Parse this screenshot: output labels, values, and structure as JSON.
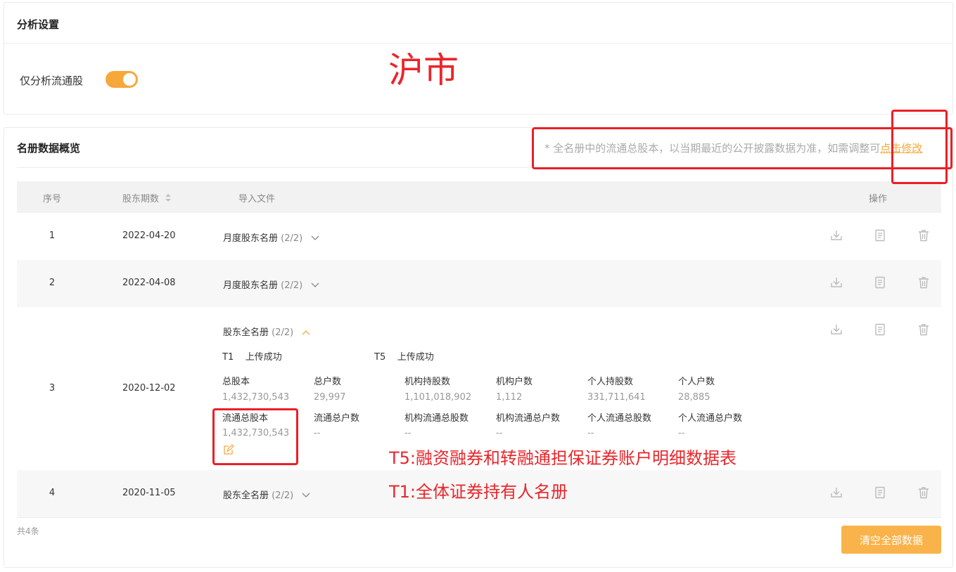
{
  "settings": {
    "title": "分析设置",
    "only_float_label": "仅分析流通股",
    "only_float_enabled": true
  },
  "annotations": {
    "market": "沪市",
    "t5_legend": "T5:融资融券和转融通担保证券账户明细数据表",
    "t1_legend": "T1:全体证券持有人名册",
    "color": "#e8262b"
  },
  "overview": {
    "title": "名册数据概览",
    "note_text": "* 全名册中的流通总股本，以当期最近的公开披露数据为准，如需调整可",
    "note_link": "点击修改",
    "columns": {
      "index": "序号",
      "period": "股东期数",
      "file": "导入文件",
      "ops": "操作"
    },
    "rows": [
      {
        "index": "1",
        "period": "2022-04-20",
        "file_name": "月度股东名册",
        "file_count": "(2/2)"
      },
      {
        "index": "2",
        "period": "2022-04-08",
        "file_name": "月度股东名册",
        "file_count": "(2/2)"
      },
      {
        "index": "3",
        "period": "2020-12-02",
        "file_name": "股东全名册",
        "file_count": "(2/2)",
        "uploads": [
          {
            "code": "T1",
            "status": "上传成功"
          },
          {
            "code": "T5",
            "status": "上传成功"
          }
        ],
        "stats": [
          {
            "label": "总股本",
            "value": "1,432,730,543"
          },
          {
            "label": "总户数",
            "value": "29,997"
          },
          {
            "label": "机构持股数",
            "value": "1,101,018,902"
          },
          {
            "label": "机构户数",
            "value": "1,112"
          },
          {
            "label": "个人持股数",
            "value": "331,711,641"
          },
          {
            "label": "个人户数",
            "value": "28,885"
          },
          {
            "label": "流通总股本",
            "value": "1,432,730,543"
          },
          {
            "label": "流通总户数",
            "value": "--"
          },
          {
            "label": "机构流通总股数",
            "value": "--"
          },
          {
            "label": "机构流通总户数",
            "value": "--"
          },
          {
            "label": "个人流通总股数",
            "value": "--"
          },
          {
            "label": "个人流通总户数",
            "value": "--"
          }
        ]
      },
      {
        "index": "4",
        "period": "2020-11-05",
        "file_name": "股东全名册",
        "file_count": "(2/2)"
      }
    ],
    "total": "共4条",
    "clear_button": "清空全部数据"
  },
  "colors": {
    "accent": "#f7a83a",
    "button": "#f9b34a",
    "header_bg": "#f2f2f2"
  }
}
